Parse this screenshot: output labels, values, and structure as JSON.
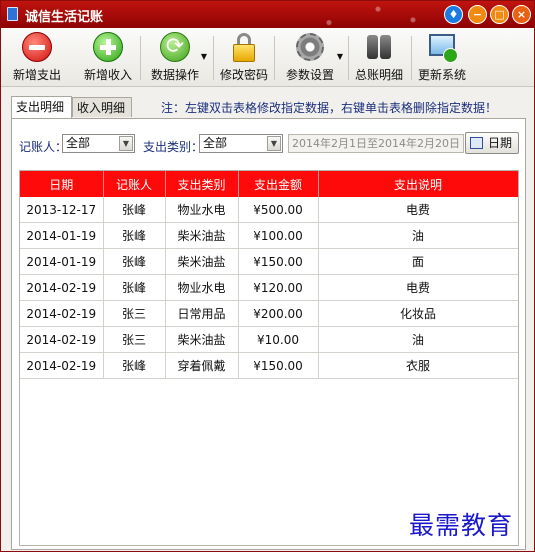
{
  "window": {
    "title": "诚信生活记账"
  },
  "titlebar_buttons": {
    "skin": "skin-icon",
    "minimize": "−",
    "maximize": "□",
    "close": "×"
  },
  "toolbar": {
    "items": [
      {
        "label": "新增支出",
        "icon": "minus-circle-icon"
      },
      {
        "label": "新增收入",
        "icon": "plus-circle-icon"
      },
      {
        "label": "数据操作",
        "icon": "sync-icon",
        "has_dropdown": true
      },
      {
        "label": "修改密码",
        "icon": "lock-icon"
      },
      {
        "label": "参数设置",
        "icon": "gear-icon",
        "has_dropdown": true
      },
      {
        "label": "总账明细",
        "icon": "binoculars-icon"
      },
      {
        "label": "更新系统",
        "icon": "update-screen-icon"
      }
    ]
  },
  "tabs": [
    {
      "label": "支出明细",
      "active": true
    },
    {
      "label": "收入明细",
      "active": false
    }
  ],
  "hint": "注：左键双击表格修改指定数据，右键单击表格删除指定数据！",
  "filters": {
    "person_label": "记账人：",
    "person_value": "全部",
    "category_label": "支出类别：",
    "category_value": "全部",
    "date_range": "2014年2月1日至2014年2月20日",
    "date_button": "日期"
  },
  "table": {
    "columns": [
      "日期",
      "记账人",
      "支出类别",
      "支出金额",
      "支出说明"
    ],
    "rows": [
      [
        "2013-12-17",
        "张峰",
        "物业水电",
        "¥500.00",
        "电费"
      ],
      [
        "2014-01-19",
        "张峰",
        "柴米油盐",
        "¥100.00",
        "油"
      ],
      [
        "2014-01-19",
        "张峰",
        "柴米油盐",
        "¥150.00",
        "面"
      ],
      [
        "2014-02-19",
        "张峰",
        "物业水电",
        "¥120.00",
        "电费"
      ],
      [
        "2014-02-19",
        "张三",
        "日常用品",
        "¥200.00",
        "化妆品"
      ],
      [
        "2014-02-19",
        "张三",
        "柴米油盐",
        "¥10.00",
        "油"
      ],
      [
        "2014-02-19",
        "张峰",
        "穿着佩戴",
        "¥150.00",
        "衣服"
      ]
    ]
  },
  "watermark": "最需教育",
  "colors": {
    "title_bar": "#a80a08",
    "table_header": "#ff0a0a",
    "hint_text": "#1b2f7c"
  }
}
